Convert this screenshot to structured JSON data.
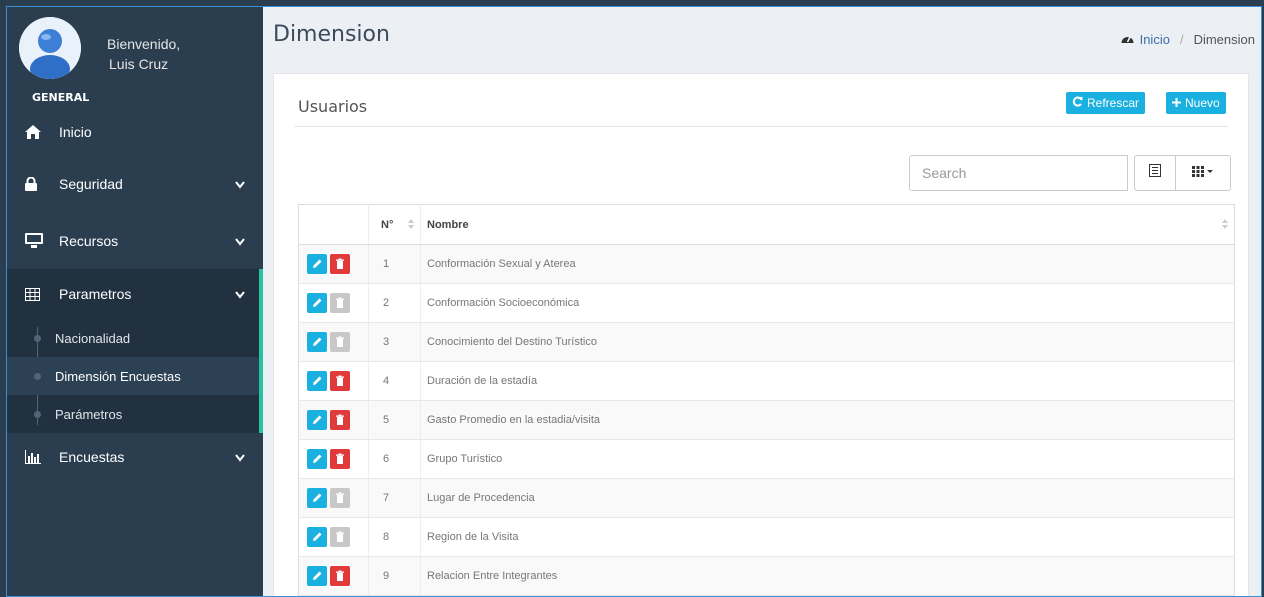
{
  "user": {
    "greeting": "Bienvenido,",
    "name": "Luis Cruz",
    "role": "GENERAL"
  },
  "nav": [
    {
      "label": "Inicio",
      "icon": "home-icon"
    },
    {
      "label": "Seguridad",
      "icon": "lock-icon"
    },
    {
      "label": "Recursos",
      "icon": "monitor-icon"
    },
    {
      "label": "Parametros",
      "icon": "table-icon"
    },
    {
      "label": "Encuestas",
      "icon": "bar-chart-icon"
    }
  ],
  "subnav": [
    {
      "label": "Nacionalidad"
    },
    {
      "label": "Dimensión Encuestas"
    },
    {
      "label": "Parámetros"
    }
  ],
  "page": {
    "title": "Dimension"
  },
  "breadcrumb": {
    "home": "Inicio",
    "current": "Dimension"
  },
  "box": {
    "title": "Usuarios",
    "refresh_label": "Refrescar",
    "new_label": "Nuevo"
  },
  "search": {
    "placeholder": "Search"
  },
  "table": {
    "columns": [
      "N°",
      "Nombre"
    ],
    "rows": [
      {
        "n": "1",
        "nombre": "Conformación Sexual y Aterea",
        "delete_enabled": true
      },
      {
        "n": "2",
        "nombre": "Conformación Socioeconómica",
        "delete_enabled": false
      },
      {
        "n": "3",
        "nombre": "Conocimiento del Destino Turístico",
        "delete_enabled": false
      },
      {
        "n": "4",
        "nombre": "Duración de la estadía",
        "delete_enabled": true
      },
      {
        "n": "5",
        "nombre": "Gasto Promedio en la estadia/visita",
        "delete_enabled": true
      },
      {
        "n": "6",
        "nombre": "Grupo Turístico",
        "delete_enabled": true
      },
      {
        "n": "7",
        "nombre": "Lugar de Procedencia",
        "delete_enabled": false
      },
      {
        "n": "8",
        "nombre": "Region de la Visita",
        "delete_enabled": false
      },
      {
        "n": "9",
        "nombre": "Relacion Entre Integrantes",
        "delete_enabled": true
      }
    ]
  },
  "colors": {
    "sidebar": "#2b3e50",
    "accent": "#1ab0e0",
    "danger": "#e03a3a",
    "active_bar": "#27c39f"
  }
}
